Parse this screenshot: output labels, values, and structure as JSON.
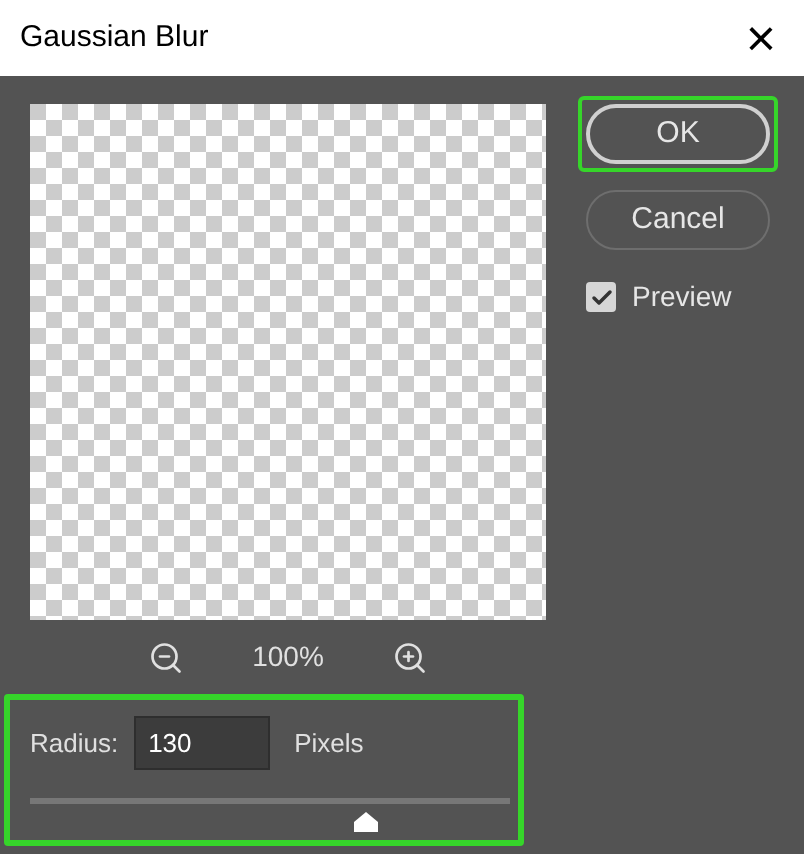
{
  "window": {
    "title": "Gaussian Blur",
    "close": "×"
  },
  "zoom": {
    "level_text": "100%"
  },
  "buttons": [
    {
      "label": "OK",
      "highlighted": true
    },
    {
      "label": "Cancel",
      "highlighted": false
    }
  ],
  "preview": {
    "label": "Preview",
    "checked": true
  },
  "radius": {
    "label": "Radius:",
    "value": "130",
    "unit": "Pixels",
    "level": 0.7,
    "highlighted": true
  }
}
